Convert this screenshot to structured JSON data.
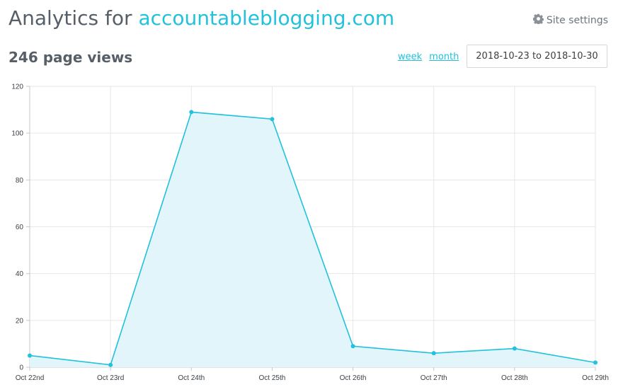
{
  "header": {
    "prefix": "Analytics for ",
    "domain": "accountableblogging.com"
  },
  "settings": {
    "label": "Site settings",
    "icon": "gear-icon"
  },
  "summary": {
    "page_views": "246 page views"
  },
  "range": {
    "week_label": "week",
    "month_label": "month",
    "date_range": "2018-10-23 to 2018-10-30"
  },
  "colors": {
    "accent": "#22c1dc",
    "area_fill": "#e1f5fa",
    "grid": "#e6e6e6"
  },
  "chart_data": {
    "type": "area",
    "categories": [
      "Oct 22nd",
      "Oct 23rd",
      "Oct 24th",
      "Oct 25th",
      "Oct 26th",
      "Oct 27th",
      "Oct 28th",
      "Oct 29th"
    ],
    "series": [
      {
        "values": [
          5,
          1,
          109,
          106,
          9,
          6,
          8,
          2
        ]
      }
    ],
    "ylim": [
      0,
      120
    ],
    "yticks": [
      0,
      20,
      40,
      60,
      80,
      100,
      120
    ],
    "grid": true,
    "legend": "none",
    "title": "",
    "xlabel": "",
    "ylabel": ""
  }
}
